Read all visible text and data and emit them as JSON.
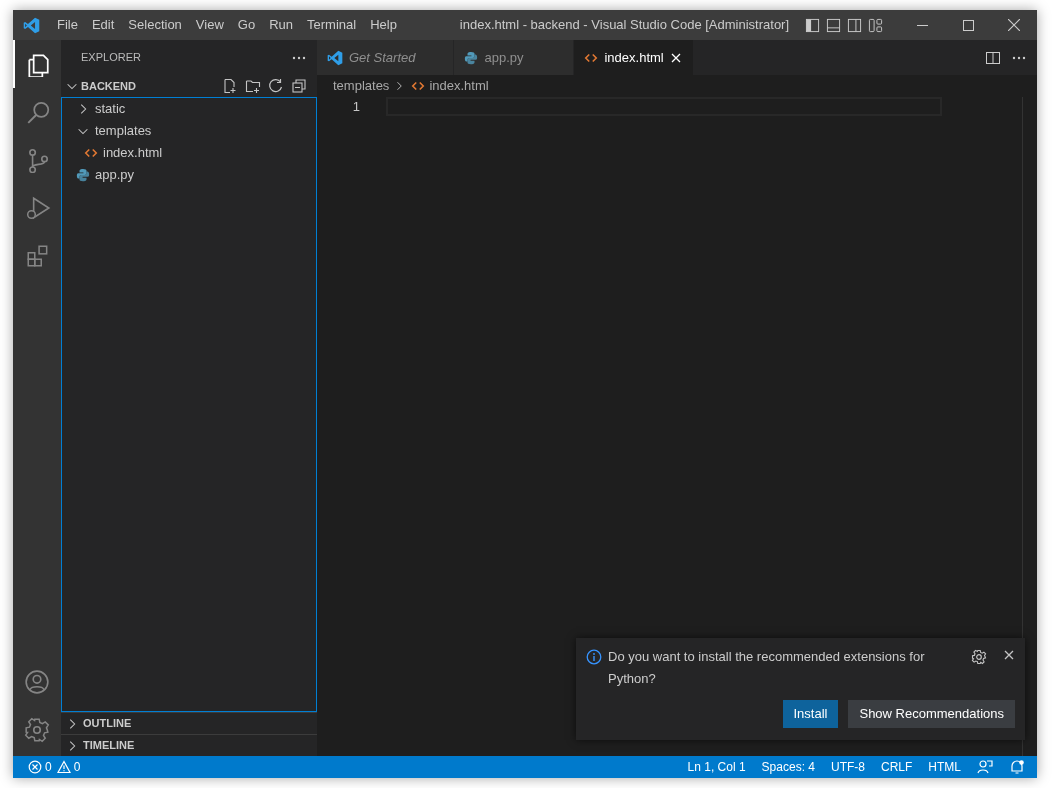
{
  "window": {
    "title": "index.html - backend - Visual Studio Code [Administrator]"
  },
  "menu": [
    "File",
    "Edit",
    "Selection",
    "View",
    "Go",
    "Run",
    "Terminal",
    "Help"
  ],
  "activity_bar": [
    {
      "kind": "explorer",
      "selected": true
    },
    {
      "kind": "search",
      "selected": false
    },
    {
      "kind": "source-control",
      "selected": false
    },
    {
      "kind": "run",
      "selected": false
    },
    {
      "kind": "extensions",
      "selected": false
    }
  ],
  "activity_bar_bottom": [
    {
      "kind": "account"
    },
    {
      "kind": "settings"
    }
  ],
  "sidebar": {
    "title": "EXPLORER",
    "section": {
      "label": "BACKEND",
      "expanded": true
    },
    "tree": [
      {
        "label": "static",
        "kind": "folder",
        "expanded": false
      },
      {
        "label": "templates",
        "kind": "folder",
        "expanded": true,
        "children": [
          {
            "label": "index.html",
            "kind": "html"
          }
        ]
      },
      {
        "label": "app.py",
        "kind": "python"
      }
    ],
    "panels": [
      {
        "label": "OUTLINE",
        "expanded": false
      },
      {
        "label": "TIMELINE",
        "expanded": false
      }
    ]
  },
  "tabs": [
    {
      "label": "Get Started",
      "kind": "welcome",
      "preview": true,
      "selected": false
    },
    {
      "label": "app.py",
      "kind": "python",
      "preview": false,
      "selected": false
    },
    {
      "label": "index.html",
      "kind": "html",
      "preview": false,
      "selected": true
    }
  ],
  "breadcrumb": [
    {
      "label": "templates",
      "kind": "folder"
    },
    {
      "label": "index.html",
      "kind": "html"
    }
  ],
  "editor": {
    "line_numbers": [
      "1"
    ]
  },
  "notification": {
    "message": "Do you want to install the recommended extensions for Python?",
    "buttons": [
      {
        "label": "Install",
        "primary": true
      },
      {
        "label": "Show Recommendations",
        "primary": false
      }
    ]
  },
  "status_bar": {
    "errors": "0",
    "warnings": "0",
    "right": [
      "Ln 1, Col 1",
      "Spaces: 4",
      "UTF-8",
      "CRLF",
      "HTML"
    ]
  }
}
